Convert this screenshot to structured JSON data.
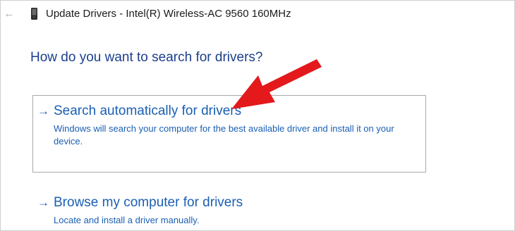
{
  "window": {
    "title": "Update Drivers - Intel(R) Wireless-AC 9560 160MHz",
    "back_icon": "←"
  },
  "heading": "How do you want to search for drivers?",
  "options": [
    {
      "arrow": "→",
      "title": "Search automatically for drivers",
      "description": "Windows will search your computer for the best available driver and install it on your device."
    },
    {
      "arrow": "→",
      "title": "Browse my computer for drivers",
      "description": "Locate and install a driver manually."
    }
  ],
  "colors": {
    "heading": "#1b3f8c",
    "link": "#1a5fb4",
    "annotation_arrow": "#e3191c",
    "box_border": "#a9a9a9"
  }
}
